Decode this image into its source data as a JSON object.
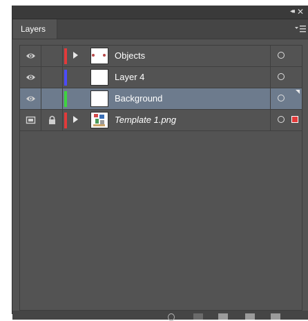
{
  "panel": {
    "tab_label": "Layers",
    "collapse_glyph": "◂◂",
    "close_glyph": "✕"
  },
  "colors": {
    "panel_bg": "#535353",
    "selected_row": "#6d7b8d",
    "layer_red": "#e23a3a",
    "layer_blue": "#4b4bff",
    "layer_green": "#3fd43f"
  },
  "layers": [
    {
      "name": "Objects",
      "visibility": "eye-icon",
      "locked": false,
      "expandable": true,
      "color": "#e23a3a",
      "italic": false,
      "selected": false,
      "thumbnail": "dots"
    },
    {
      "name": "Layer 4",
      "visibility": "eye-icon",
      "locked": false,
      "expandable": false,
      "color": "#4b4bff",
      "italic": false,
      "selected": false,
      "thumbnail": "blank"
    },
    {
      "name": "Background",
      "visibility": "eye-icon",
      "locked": false,
      "expandable": false,
      "color": "#3fd43f",
      "italic": false,
      "selected": true,
      "thumbnail": "blank"
    },
    {
      "name": "Template 1.png",
      "visibility": "template-icon",
      "locked": true,
      "expandable": true,
      "color": "#e23a3a",
      "italic": true,
      "selected": false,
      "thumbnail": "image"
    }
  ]
}
